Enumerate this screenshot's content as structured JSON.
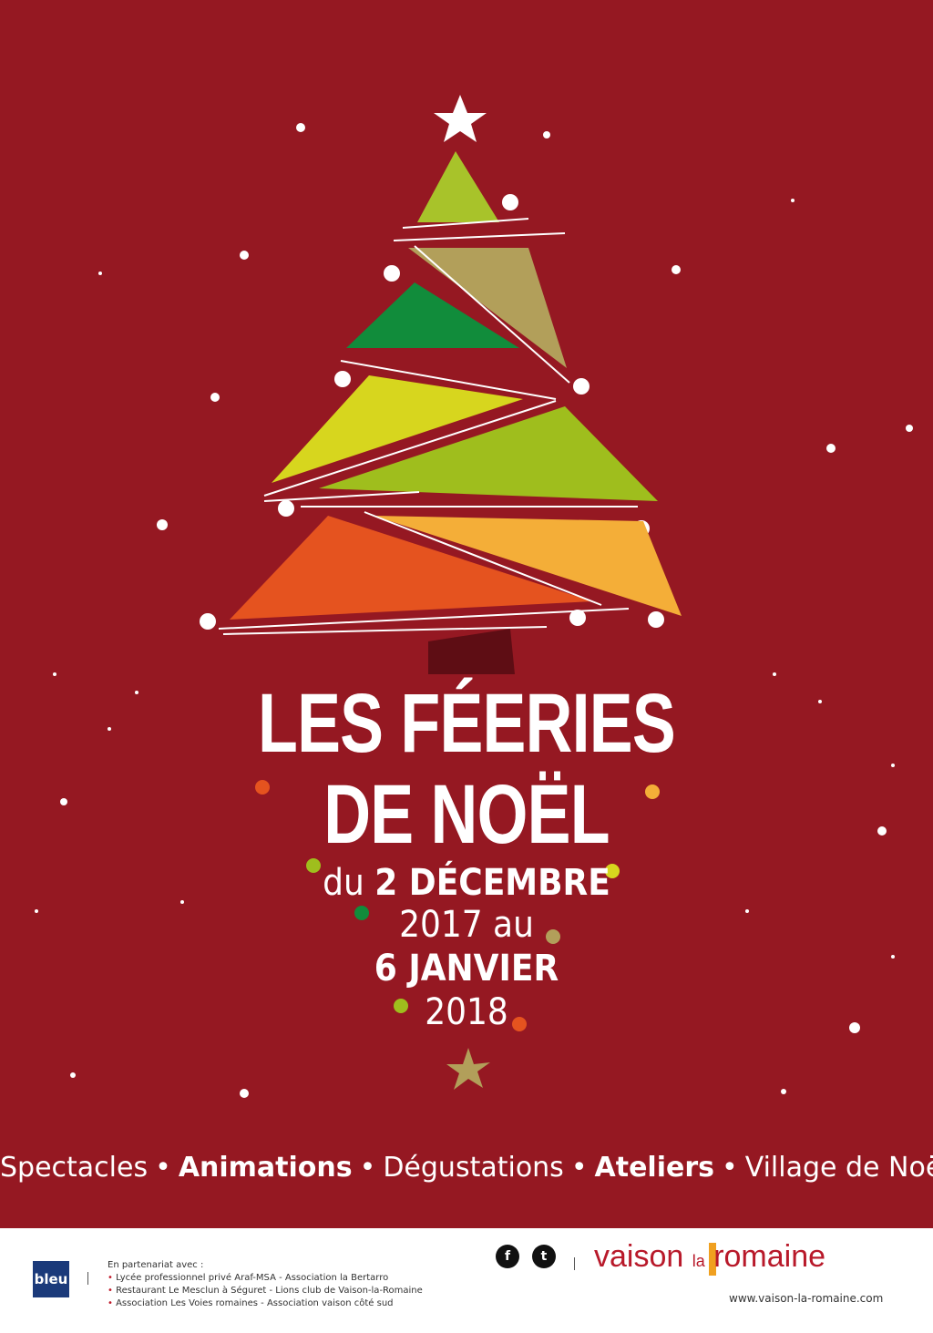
{
  "poster": {
    "title_line1": "LES FÉERIES",
    "title_line2": "DE NOËL",
    "date_line1_light": "du ",
    "date_line1_bold": "2 DÉCEMBRE",
    "date_line2": "2017 au",
    "date_line3": "6 JANVIER",
    "date_line4": "2018",
    "activities": {
      "a1": "Spectacles",
      "a2": "Animations",
      "a3": "Dégustations",
      "a4": "Ateliers",
      "a5": "Village de Noël",
      "separator": "•"
    },
    "colors": {
      "background": "#951822",
      "accent_orange": "#f0a020"
    }
  },
  "footer": {
    "radio_logo": "bleu",
    "partners_heading": "En partenariat avec :",
    "partners": [
      "Lycée professionnel privé Araf-MSA - Association la Bertarro",
      "Restaurant Le Mesclun à Séguret - Lions club de Vaison-la-Romaine",
      "Association Les Voies romaines - Association vaison côté sud"
    ],
    "social": {
      "facebook": "f",
      "twitter": "t"
    },
    "brand_vaison": "vaison",
    "brand_la": "la",
    "brand_romaine": "romaine",
    "website": "www.vaison-la-romaine.com"
  }
}
